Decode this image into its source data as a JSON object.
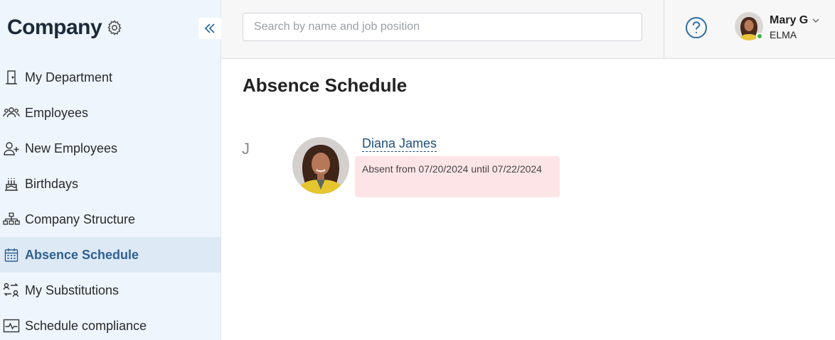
{
  "sidebar": {
    "title": "Company",
    "items": [
      {
        "label": "My Department",
        "icon": "door-icon"
      },
      {
        "label": "Employees",
        "icon": "people-icon"
      },
      {
        "label": "New Employees",
        "icon": "person-add-icon"
      },
      {
        "label": "Birthdays",
        "icon": "cake-icon"
      },
      {
        "label": "Company Structure",
        "icon": "org-chart-icon"
      },
      {
        "label": "Absence Schedule",
        "icon": "calendar-icon",
        "active": true
      },
      {
        "label": "My Substitutions",
        "icon": "swap-icon"
      },
      {
        "label": "Schedule compliance",
        "icon": "pulse-icon"
      }
    ]
  },
  "header": {
    "search_placeholder": "Search by name and job position",
    "search_value": "",
    "user": {
      "name": "Mary G",
      "org": "ELMA",
      "status": "online"
    }
  },
  "main": {
    "title": "Absence Schedule",
    "groups": [
      {
        "letter": "J",
        "employees": [
          {
            "name": "Diana James",
            "absence": "Absent from 07/20/2024 until 07/22/2024"
          }
        ]
      }
    ]
  },
  "colors": {
    "accent": "#2f6190",
    "sidebar_bg": "#eef5fc",
    "active_bg": "#dde9f5",
    "absence_bg": "#fde5e7",
    "online": "#3cb34a"
  }
}
